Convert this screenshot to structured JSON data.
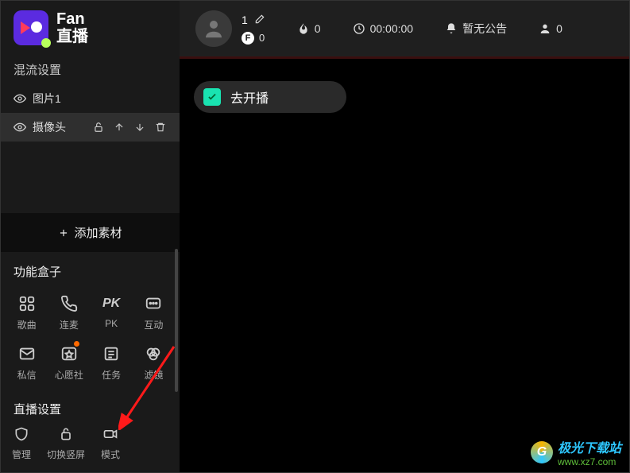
{
  "logo": {
    "line1": "Fan",
    "line2": "直播"
  },
  "mixer": {
    "title": "混流设置",
    "items": [
      {
        "label": "图片1"
      },
      {
        "label": "摄像头"
      }
    ]
  },
  "add_source": "添加素材",
  "func_box": {
    "title": "功能盒子",
    "items": [
      {
        "label": "歌曲",
        "icon": "grid-icon"
      },
      {
        "label": "连麦",
        "icon": "phone-icon"
      },
      {
        "label": "PK",
        "icon": "pk-icon"
      },
      {
        "label": "互动",
        "icon": "chat-icon"
      },
      {
        "label": "私信",
        "icon": "mail-icon"
      },
      {
        "label": "心愿社",
        "icon": "star-icon",
        "notif": true
      },
      {
        "label": "任务",
        "icon": "task-icon"
      },
      {
        "label": "滤镜",
        "icon": "filter-icon"
      }
    ]
  },
  "live_settings": {
    "title": "直播设置",
    "items": [
      {
        "label": "管理",
        "icon": "shield-icon"
      },
      {
        "label": "切换竖屏",
        "icon": "lock-icon"
      },
      {
        "label": "模式",
        "icon": "camera-mode-icon"
      }
    ]
  },
  "topbar": {
    "user_id": "1",
    "fpoints": "0",
    "fire": "0",
    "duration": "00:00:00",
    "announcement": "暂无公告",
    "viewers": "0"
  },
  "go_live": {
    "label": "去开播"
  },
  "watermark": {
    "name": "极光下载站",
    "url": "www.xz7.com"
  }
}
